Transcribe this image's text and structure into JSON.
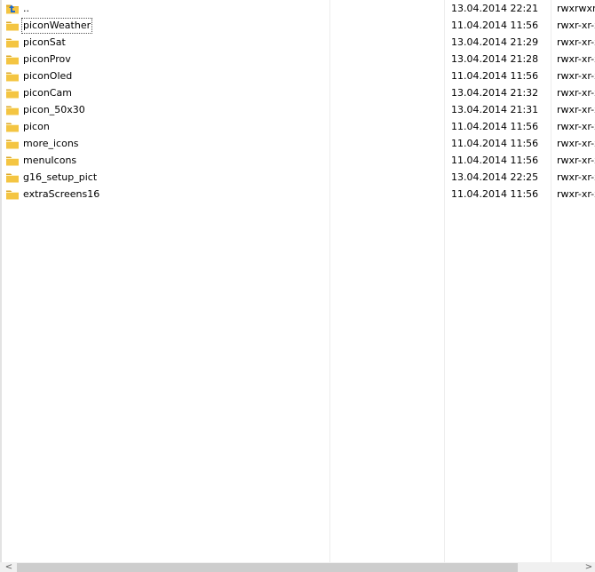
{
  "files": [
    {
      "name": "..",
      "date": "13.04.2014 22:21",
      "perms": "rwxrwxrwx",
      "icon": "folder-up-icon"
    },
    {
      "name": "piconWeather",
      "date": "11.04.2014 11:56",
      "perms": "rwxr-xr-x",
      "icon": "folder-icon",
      "focused": true
    },
    {
      "name": "piconSat",
      "date": "13.04.2014 21:29",
      "perms": "rwxr-xr-x",
      "icon": "folder-icon"
    },
    {
      "name": "piconProv",
      "date": "13.04.2014 21:28",
      "perms": "rwxr-xr-x",
      "icon": "folder-icon"
    },
    {
      "name": "piconOled",
      "date": "11.04.2014 11:56",
      "perms": "rwxr-xr-x",
      "icon": "folder-icon"
    },
    {
      "name": "piconCam",
      "date": "13.04.2014 21:32",
      "perms": "rwxr-xr-x",
      "icon": "folder-icon"
    },
    {
      "name": "picon_50x30",
      "date": "13.04.2014 21:31",
      "perms": "rwxr-xr-x",
      "icon": "folder-icon"
    },
    {
      "name": "picon",
      "date": "11.04.2014 11:56",
      "perms": "rwxr-xr-x",
      "icon": "folder-icon"
    },
    {
      "name": "more_icons",
      "date": "11.04.2014 11:56",
      "perms": "rwxr-xr-x",
      "icon": "folder-icon"
    },
    {
      "name": "menuIcons",
      "date": "11.04.2014 11:56",
      "perms": "rwxr-xr-x",
      "icon": "folder-icon"
    },
    {
      "name": "g16_setup_pict",
      "date": "13.04.2014 22:25",
      "perms": "rwxr-xr-x",
      "icon": "folder-icon"
    },
    {
      "name": "extraScreens16",
      "date": "11.04.2014 11:56",
      "perms": "rwxr-xr-x",
      "icon": "folder-icon"
    }
  ],
  "scrollbar": {
    "left_arrow": "<",
    "right_arrow": ">"
  },
  "colors": {
    "folder": "#f4c542",
    "folder_dark": "#dca82a",
    "up_arrow": "#1e6ad0"
  }
}
